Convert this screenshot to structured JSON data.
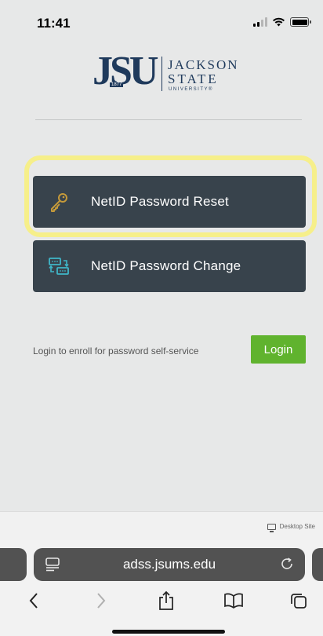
{
  "status_bar": {
    "time": "11:41"
  },
  "logo": {
    "mark": "JSU",
    "year": "1877",
    "line1": "JACKSON",
    "line2": "STATE",
    "line3": "UNIVERSITY®"
  },
  "actions": {
    "reset": {
      "label": "NetID Password Reset",
      "icon": "key-icon"
    },
    "change": {
      "label": "NetID Password Change",
      "icon": "network-transfer-icon"
    }
  },
  "enroll": {
    "text": "Login to enroll for password self-service",
    "button_label": "Login"
  },
  "safari": {
    "desktop_site_label": "Desktop Site",
    "url": "adss.jsums.edu"
  },
  "colors": {
    "tile": "#38434c",
    "login": "#60b32e",
    "highlight": "#f6ef8a",
    "logo": "#1f3a5c",
    "key_icon": "#c59a3a",
    "change_icon": "#3fb6c8"
  }
}
